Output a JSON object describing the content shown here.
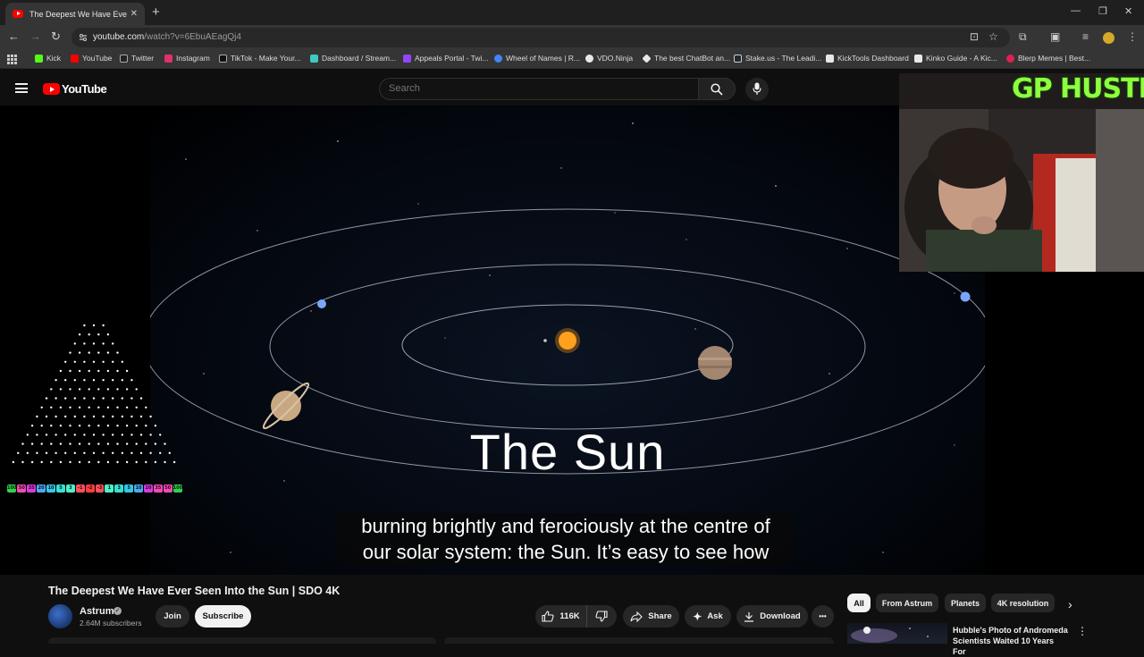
{
  "browser": {
    "tab_title": "The Deepest We Have Ever See",
    "tab_close": "✕",
    "new_tab": "+",
    "url_host": "youtube.com",
    "url_path": "/watch?v=6EbuAEagQj4",
    "bookmarks": [
      {
        "label": "Kick",
        "color": "#53fc18"
      },
      {
        "label": "YouTube",
        "color": "#ff0000"
      },
      {
        "label": "Twitter",
        "color": "#222222"
      },
      {
        "label": "Instagram",
        "color": "#e1306c"
      },
      {
        "label": "TikTok - Make Your...",
        "color": "#111111"
      },
      {
        "label": "Dashboard / Stream...",
        "color": "#3ec9c1"
      },
      {
        "label": "Appeals Portal - Twi...",
        "color": "#9146ff"
      },
      {
        "label": "Wheel of Names | R...",
        "color": "#4285f4"
      },
      {
        "label": "VDO.Ninja",
        "color": "#e8e8e8"
      },
      {
        "label": "The best ChatBot an...",
        "color": "#e8e8e8"
      },
      {
        "label": "Stake.us - The Leadi...",
        "color": "#1f2a35"
      },
      {
        "label": "KickTools Dashboard",
        "color": "#e8e8e8"
      },
      {
        "label": "Kinko Guide - A Kic...",
        "color": "#e8e8e8"
      },
      {
        "label": "Blerp Memes | Best...",
        "color": "#e01f52"
      }
    ]
  },
  "youtube": {
    "logo_text": "YouTube",
    "search_placeholder": "Search"
  },
  "video": {
    "overlay_title": "The Sun",
    "caption_line1": "burning brightly and ferociously at the centre of",
    "caption_line2": "our solar system: the Sun. It’s easy to see how",
    "webcam_label": "GP HUSTLA",
    "plinko_multipliers": [
      "100",
      "50",
      "35",
      "20",
      "10",
      "5",
      "3",
      "-1",
      "-2",
      "-3",
      "1",
      "3",
      "5",
      "10",
      "20",
      "35",
      "50",
      "100"
    ]
  },
  "meta": {
    "title": "The Deepest We Have Ever Seen Into the Sun | SDO 4K",
    "channel_name": "Astrum",
    "verified_mark": "✓",
    "subscribers": "2.64M subscribers",
    "join_label": "Join",
    "subscribe_label": "Subscribe",
    "likes": "116K",
    "share_label": "Share",
    "ask_label": "Ask",
    "download_label": "Download",
    "more_label": "•••"
  },
  "chips": [
    "All",
    "From Astrum",
    "Planets",
    "4K resolution"
  ],
  "recommendation": {
    "title": "Hubble's Photo of Andromeda Scientists Waited 10 Years For",
    "more": "⋮"
  },
  "colors": {
    "accent_red": "#ff0000",
    "webcam_label": "#8dff3e"
  }
}
